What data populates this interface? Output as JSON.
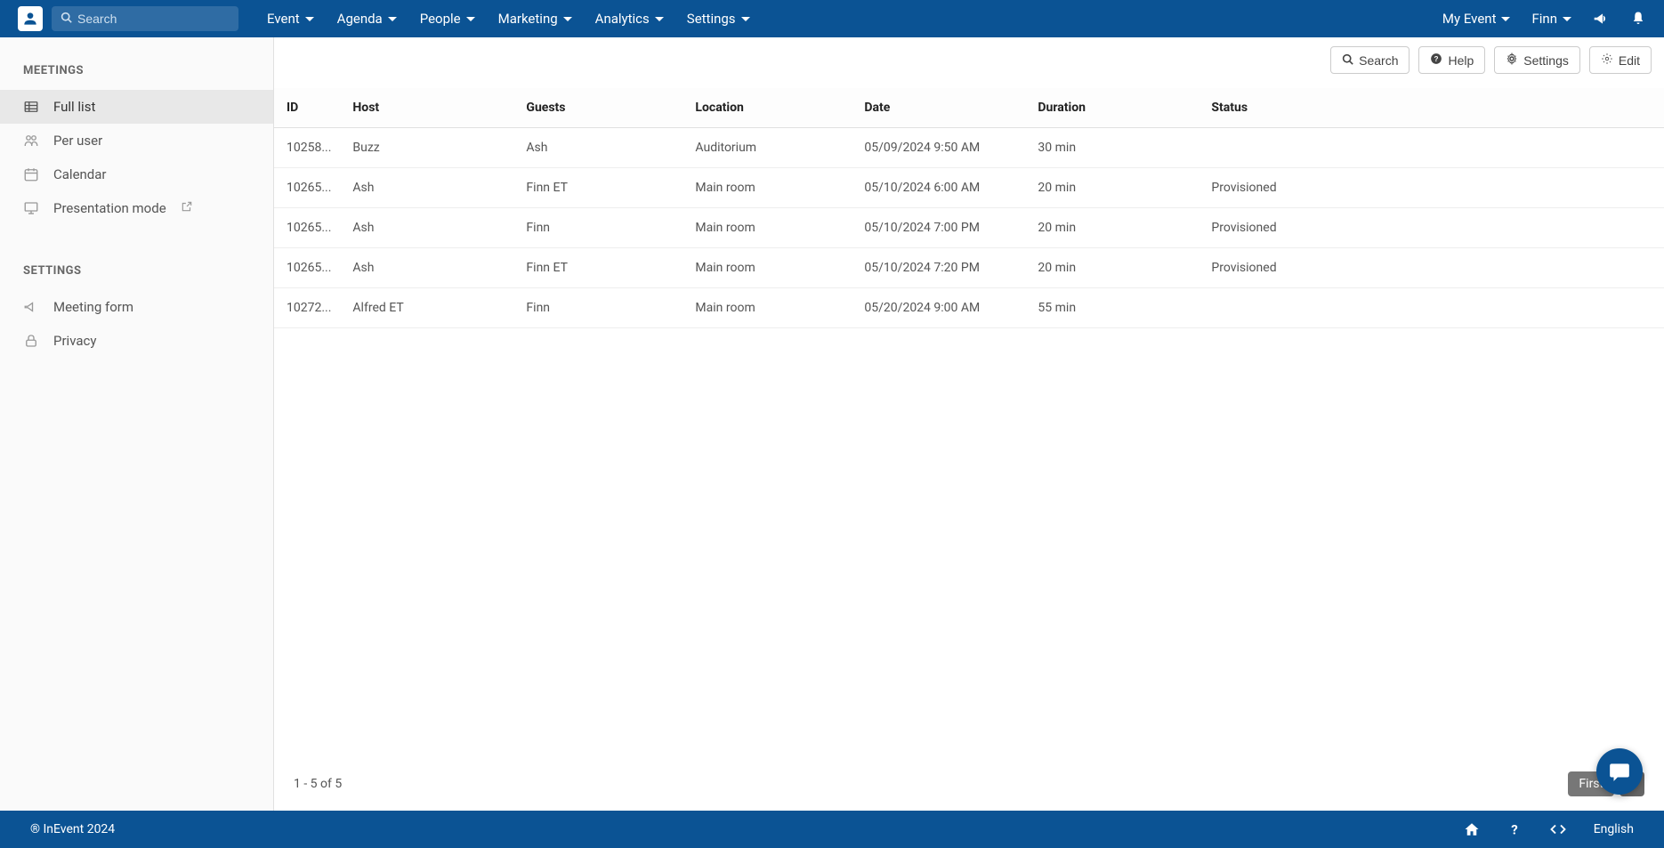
{
  "nav": {
    "search_placeholder": "Search",
    "items": [
      "Event",
      "Agenda",
      "People",
      "Marketing",
      "Analytics",
      "Settings"
    ],
    "right": {
      "my_event": "My Event",
      "user": "Finn"
    }
  },
  "sidebar": {
    "section1_heading": "MEETINGS",
    "section1_items": [
      {
        "label": "Full list"
      },
      {
        "label": "Per user"
      },
      {
        "label": "Calendar"
      },
      {
        "label": "Presentation mode"
      }
    ],
    "section2_heading": "SETTINGS",
    "section2_items": [
      {
        "label": "Meeting form"
      },
      {
        "label": "Privacy"
      }
    ]
  },
  "toolbar": {
    "search": "Search",
    "help": "Help",
    "settings": "Settings",
    "edit": "Edit"
  },
  "table": {
    "headers": {
      "id": "ID",
      "host": "Host",
      "guests": "Guests",
      "location": "Location",
      "date": "Date",
      "duration": "Duration",
      "status": "Status"
    },
    "rows": [
      {
        "id": "10258...",
        "host": "Buzz",
        "guests": "Ash",
        "location": "Auditorium",
        "date": "05/09/2024 9:50 AM",
        "duration": "30 min",
        "status": ""
      },
      {
        "id": "10265...",
        "host": "Ash",
        "guests": "Finn ET",
        "location": "Main room",
        "date": "05/10/2024 6:00 AM",
        "duration": "20 min",
        "status": "Provisioned"
      },
      {
        "id": "10265...",
        "host": "Ash",
        "guests": "Finn",
        "location": "Main room",
        "date": "05/10/2024 7:00 PM",
        "duration": "20 min",
        "status": "Provisioned"
      },
      {
        "id": "10265...",
        "host": "Ash",
        "guests": "Finn ET",
        "location": "Main room",
        "date": "05/10/2024 7:20 PM",
        "duration": "20 min",
        "status": "Provisioned"
      },
      {
        "id": "10272...",
        "host": "Alfred ET",
        "guests": "Finn",
        "location": "Main room",
        "date": "05/20/2024 9:00 AM",
        "duration": "55 min",
        "status": ""
      }
    ]
  },
  "pagination": {
    "summary": "1 - 5 of 5",
    "first": "First",
    "page": "1"
  },
  "footer": {
    "copyright": "® InEvent 2024",
    "language": "English"
  }
}
